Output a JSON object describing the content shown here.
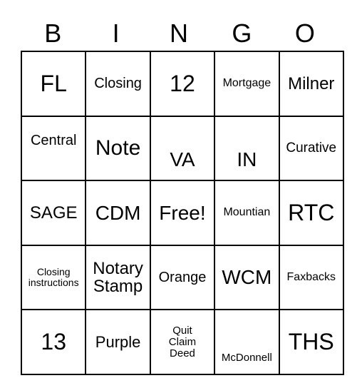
{
  "header": {
    "letters": [
      "B",
      "I",
      "N",
      "G",
      "O"
    ]
  },
  "board": {
    "rows": [
      [
        "FL",
        "Closing",
        "12",
        "Mortgage",
        "Milner"
      ],
      [
        "Central",
        "Note",
        "VA",
        "IN",
        "Curative"
      ],
      [
        "SAGE",
        "CDM",
        "Free!",
        "Mountian",
        "RTC"
      ],
      [
        "Closing\ninstructions",
        "Notary\nStamp",
        "Orange",
        "WCM",
        "Faxbacks"
      ],
      [
        "13",
        "Purple",
        "Quit\nClaim\nDeed",
        "McDonnell",
        "THS"
      ]
    ]
  }
}
